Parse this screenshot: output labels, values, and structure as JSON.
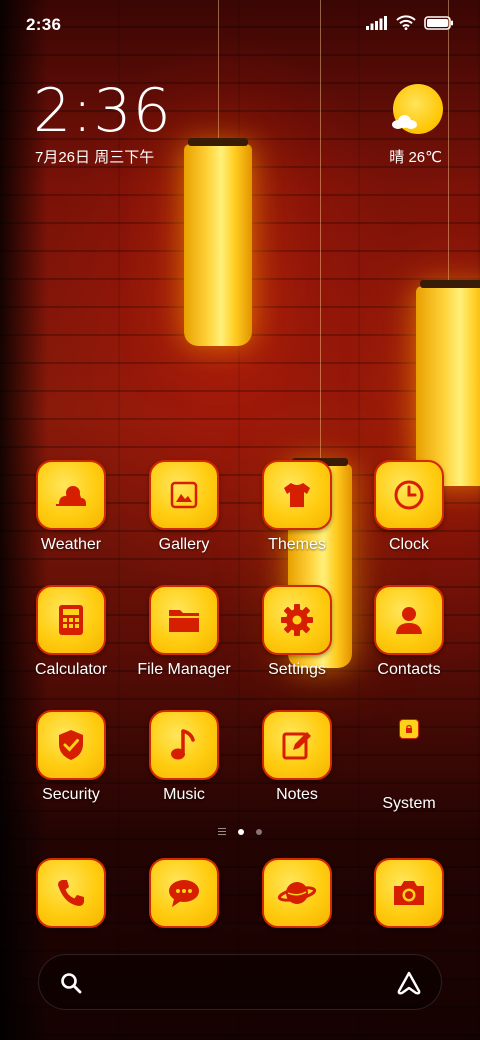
{
  "status_bar": {
    "time": "2:36"
  },
  "widget": {
    "time": "2:36",
    "date": "7月26日 周三下午",
    "weather": "晴 26℃"
  },
  "apps": [
    {
      "label": "Weather",
      "icon": "weather-icon"
    },
    {
      "label": "Gallery",
      "icon": "gallery-icon"
    },
    {
      "label": "Themes",
      "icon": "tshirt-icon"
    },
    {
      "label": "Clock",
      "icon": "clock-icon"
    },
    {
      "label": "Calculator",
      "icon": "calculator-icon"
    },
    {
      "label": "File Manager",
      "icon": "folder-icon"
    },
    {
      "label": "Settings",
      "icon": "gear-icon"
    },
    {
      "label": "Contacts",
      "icon": "person-icon"
    },
    {
      "label": "Security",
      "icon": "shield-check-icon"
    },
    {
      "label": "Music",
      "icon": "music-note-icon"
    },
    {
      "label": "Notes",
      "icon": "notes-pencil-icon"
    },
    {
      "label": "System",
      "icon": "system-folder-icon"
    }
  ],
  "dock": [
    {
      "icon": "phone-icon"
    },
    {
      "icon": "message-icon"
    },
    {
      "icon": "browser-planet-icon"
    },
    {
      "icon": "camera-icon"
    }
  ],
  "pages": {
    "count": 2,
    "active": 1
  },
  "colors": {
    "tile": "#ffcc10",
    "icon": "#d61e00",
    "border": "#d22a00"
  }
}
